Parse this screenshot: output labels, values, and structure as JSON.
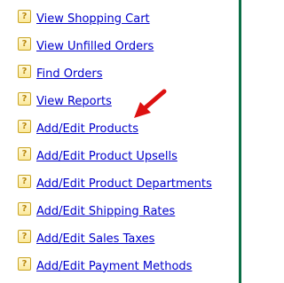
{
  "menu": {
    "items": [
      {
        "label": "View Shopping Cart",
        "icon": "help-icon"
      },
      {
        "label": "View Unfilled Orders",
        "icon": "help-icon"
      },
      {
        "label": "Find Orders",
        "icon": "help-icon"
      },
      {
        "label": "View Reports",
        "icon": "help-icon"
      },
      {
        "label": "Add/Edit Products",
        "icon": "help-icon"
      },
      {
        "label": "Add/Edit Product Upsells",
        "icon": "help-icon"
      },
      {
        "label": "Add/Edit Product Departments",
        "icon": "help-icon"
      },
      {
        "label": "Add/Edit Shipping Rates",
        "icon": "help-icon"
      },
      {
        "label": "Add/Edit Sales Taxes",
        "icon": "help-icon"
      },
      {
        "label": "Add/Edit Payment Methods",
        "icon": "help-icon"
      }
    ],
    "help_glyph": "?"
  },
  "colors": {
    "link": "#0000cc",
    "help_icon_border": "#c9a422",
    "help_icon_glyph": "#b8860b",
    "arrow": "#dd1111",
    "right_border": "#0b6e46"
  }
}
